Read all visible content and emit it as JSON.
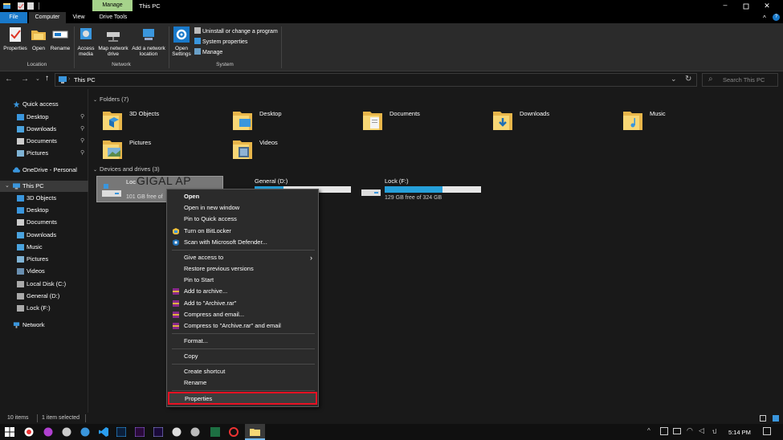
{
  "titlebar": {
    "manage_tab": "Manage",
    "title": "This PC"
  },
  "ribbon_tabs": {
    "file": "File",
    "computer": "Computer",
    "view": "View",
    "drive_tools": "Drive Tools"
  },
  "ribbon": {
    "location": {
      "label": "Location",
      "properties": "Properties",
      "open": "Open",
      "rename": "Rename"
    },
    "network": {
      "label": "Network",
      "access_media": "Access media",
      "map_drive": "Map network drive",
      "add_location": "Add a network location"
    },
    "system": {
      "label": "System",
      "open_settings": "Open Settings",
      "uninstall": "Uninstall or change a program",
      "system_properties": "System properties",
      "manage": "Manage"
    }
  },
  "address": {
    "path": "This PC",
    "search_placeholder": "Search This PC"
  },
  "nav": {
    "quick_access": "Quick access",
    "qa_items": [
      "Desktop",
      "Downloads",
      "Documents",
      "Pictures"
    ],
    "onedrive": "OneDrive - Personal",
    "this_pc": "This PC",
    "pc_items": [
      "3D Objects",
      "Desktop",
      "Documents",
      "Downloads",
      "Music",
      "Pictures",
      "Videos",
      "Local Disk (C:)",
      "General (D:)",
      "Lock (F:)"
    ],
    "network": "Network"
  },
  "content": {
    "folders_header": "Folders (7)",
    "folders": [
      "3D Objects",
      "Desktop",
      "Documents",
      "Downloads",
      "Music",
      "Pictures",
      "Videos"
    ],
    "devices_header": "Devices and drives (3)",
    "drives": [
      {
        "name": "Loc",
        "free": "101 GB free of",
        "fill": 0.7
      },
      {
        "name": "General (D:)",
        "free": "",
        "fill": 0.3
      },
      {
        "name": "Lock (F:)",
        "free": "129 GB free of 324 GB",
        "fill": 0.6
      }
    ],
    "watermark": "GIGAL AP"
  },
  "context_menu": {
    "open": "Open",
    "open_new_window": "Open in new window",
    "pin_quick_access": "Pin to Quick access",
    "bitlocker": "Turn on BitLocker",
    "defender": "Scan with Microsoft Defender...",
    "give_access": "Give access to",
    "restore": "Restore previous versions",
    "pin_start": "Pin to Start",
    "add_archive": "Add to archive...",
    "add_archive_rar": "Add to \"Archive.rar\"",
    "compress_email": "Compress and email...",
    "compress_rar_email": "Compress to \"Archive.rar\" and email",
    "format": "Format...",
    "copy": "Copy",
    "create_shortcut": "Create shortcut",
    "rename": "Rename",
    "properties": "Properties"
  },
  "status": {
    "items": "10 items",
    "selected": "1 item selected"
  },
  "taskbar": {
    "time": "5:14 PM"
  },
  "colors": {
    "accent": "#0078d7",
    "manage_tab": "#a6d38b",
    "highlight": "#e81123"
  }
}
